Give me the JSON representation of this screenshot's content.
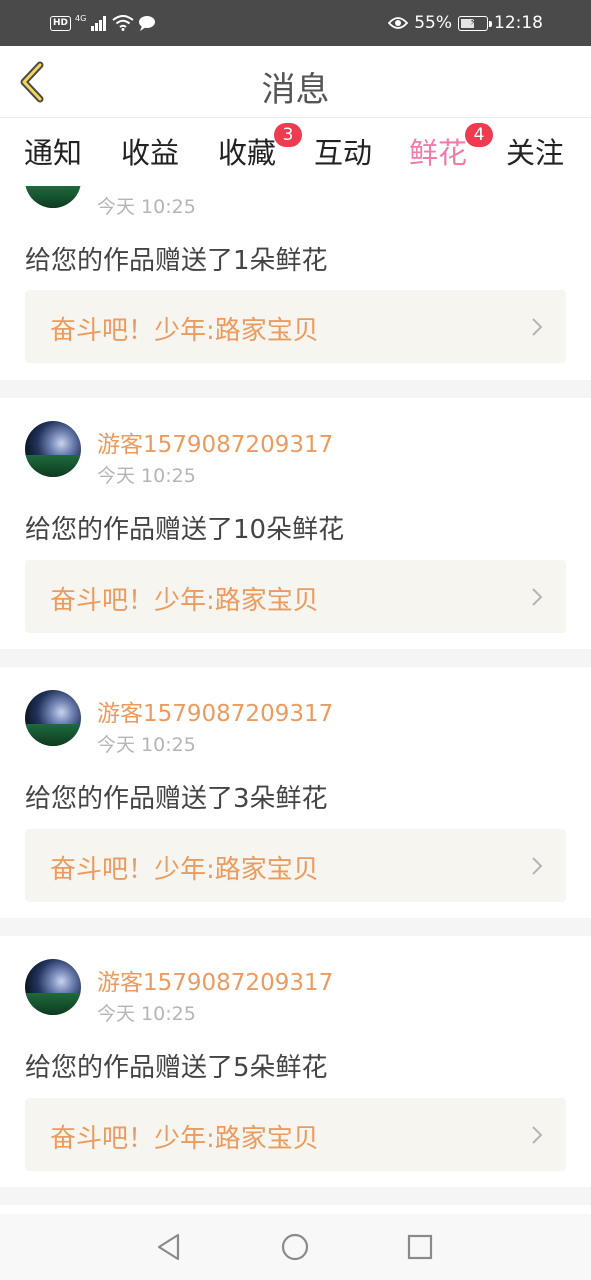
{
  "status_bar": {
    "hd": "HD",
    "network": "4G",
    "battery_text": "55%",
    "battery_level": 0.55,
    "time": "12:18"
  },
  "header": {
    "title": "消息",
    "back_icon": "chevron-left-icon"
  },
  "tabs": [
    {
      "label": "通知",
      "active": false,
      "badge": ""
    },
    {
      "label": "收益",
      "active": false,
      "badge": ""
    },
    {
      "label": "收藏",
      "active": false,
      "badge": "3"
    },
    {
      "label": "互动",
      "active": false,
      "badge": ""
    },
    {
      "label": "鲜花",
      "active": true,
      "badge": "4"
    },
    {
      "label": "关注",
      "active": false,
      "badge": ""
    }
  ],
  "messages": [
    {
      "username": "",
      "time": "今天 10:25",
      "text": "给您的作品赠送了1朵鲜花",
      "work": "奋斗吧！少年:路家宝贝"
    },
    {
      "username": "游客1579087209317",
      "time": "今天 10:25",
      "text": "给您的作品赠送了10朵鲜花",
      "work": "奋斗吧！少年:路家宝贝"
    },
    {
      "username": "游客1579087209317",
      "time": "今天 10:25",
      "text": "给您的作品赠送了3朵鲜花",
      "work": "奋斗吧！少年:路家宝贝"
    },
    {
      "username": "游客1579087209317",
      "time": "今天 10:25",
      "text": "给您的作品赠送了5朵鲜花",
      "work": "奋斗吧！少年:路家宝贝"
    }
  ],
  "colors": {
    "accent": "#f07ca8",
    "badge": "#ef3b4f",
    "username": "#ec9b5e",
    "work_box": "#f6f5ef",
    "status_bar": "#4a4a4a"
  },
  "nav_icons": [
    "back-triangle-icon",
    "home-circle-icon",
    "recents-square-icon"
  ]
}
